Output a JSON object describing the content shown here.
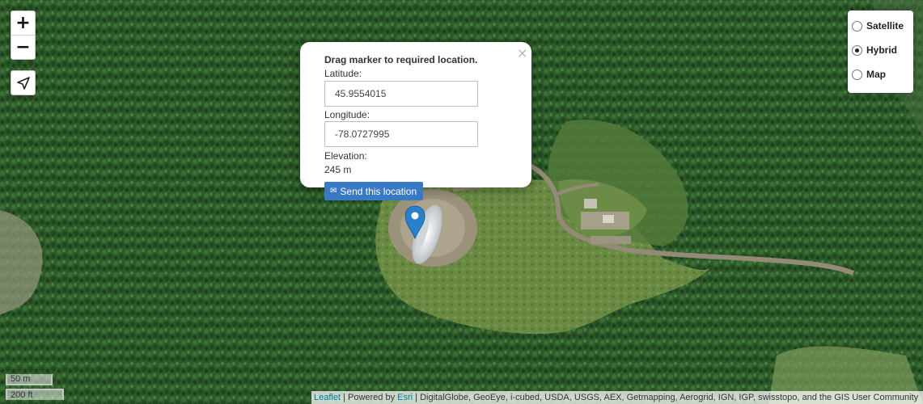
{
  "map": {
    "type": "satellite hybrid",
    "colors": {
      "forest": "#2f5a2b",
      "clearing": "#6e8d48",
      "road": "#8e8674",
      "dish": "#e8ecee"
    }
  },
  "controls": {
    "zoom_in": "+",
    "zoom_out": "−",
    "locate_icon": "navigation-arrow-icon"
  },
  "layers": [
    {
      "label": "Satellite",
      "selected": false
    },
    {
      "label": "Hybrid",
      "selected": true
    },
    {
      "label": "Map",
      "selected": false
    }
  ],
  "popup": {
    "close": "×",
    "title": "Drag marker to required location.",
    "latitude_label": "Latitude:",
    "latitude_value": "45.9554015",
    "longitude_label": "Longitude:",
    "longitude_value": "-78.0727995",
    "elevation_label": "Elevation:",
    "elevation_value": "245 m",
    "send_icon": "envelope-icon",
    "send_label": "Send this location"
  },
  "scale": {
    "metric": "50 m",
    "imperial": "200 ft"
  },
  "attribution": {
    "leaflet": "Leaflet",
    "powered_by": " | Powered by ",
    "esri": "Esri",
    "sources": " | DigitalGlobe, GeoEye, i-cubed, USDA, USGS, AEX, Getmapping, Aerogrid, IGN, IGP, swisstopo, and the GIS User Community"
  }
}
